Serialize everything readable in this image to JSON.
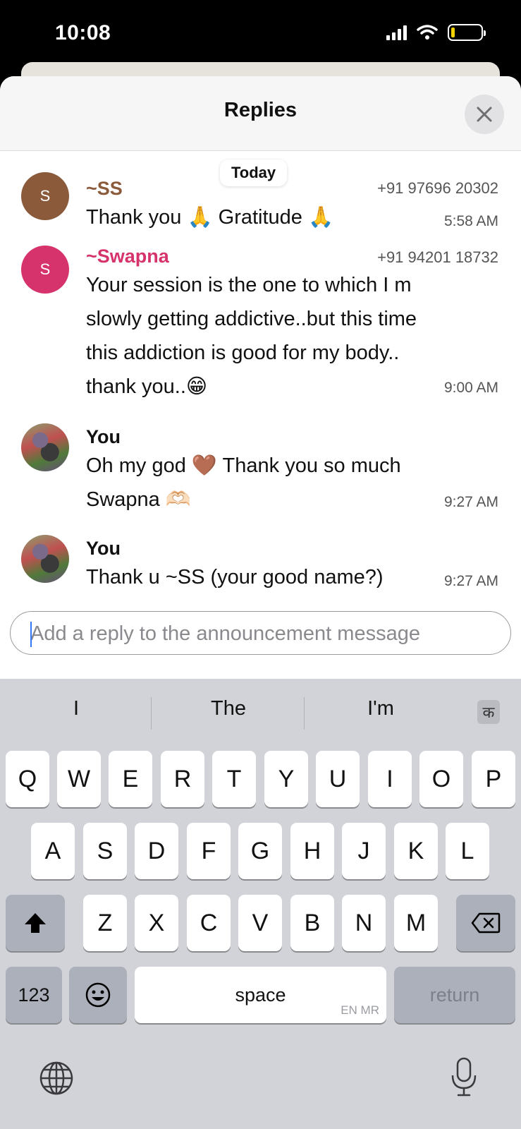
{
  "status_bar": {
    "time": "10:08"
  },
  "sheet": {
    "title": "Replies"
  },
  "date_pill": "Today",
  "messages": [
    {
      "avatar_letter": "S",
      "avatar_color": "#8a5a3b",
      "sender": "~SS",
      "sender_color": "#8a5a3b",
      "phone": "+91 97696 20302",
      "lines": [
        "Thank you 🙏 Gratitude 🙏"
      ],
      "time": "5:58 AM"
    },
    {
      "avatar_letter": "S",
      "avatar_color": "#d6336c",
      "sender": "~Swapna",
      "sender_color": "#d6336c",
      "phone": "+91 94201 18732",
      "lines": [
        "Your session is the one to which I m",
        "slowly getting addictive..but this time",
        "this addiction is good for my body..",
        "thank you..😁"
      ],
      "time": "9:00 AM"
    },
    {
      "avatar_letter": "",
      "sender": "You",
      "sender_color": "#111111",
      "phone": "",
      "lines": [
        "Oh my god 🤎 Thank you so much",
        "Swapna 🫶🏻"
      ],
      "time": "9:27 AM"
    },
    {
      "avatar_letter": "",
      "sender": "You",
      "sender_color": "#111111",
      "phone": "",
      "lines": [
        "Thank u ~SS (your good name?)"
      ],
      "time": "9:27 AM"
    }
  ],
  "reply_input": {
    "placeholder": "Add a reply to the announcement message",
    "value": ""
  },
  "keyboard": {
    "suggestions": [
      "I",
      "The",
      "I'm"
    ],
    "script_key": "क",
    "row1": [
      "Q",
      "W",
      "E",
      "R",
      "T",
      "Y",
      "U",
      "I",
      "O",
      "P"
    ],
    "row2": [
      "A",
      "S",
      "D",
      "F",
      "G",
      "H",
      "J",
      "K",
      "L"
    ],
    "row3": [
      "Z",
      "X",
      "C",
      "V",
      "B",
      "N",
      "M"
    ],
    "numbers_key": "123",
    "space_key": "space",
    "space_lang": "EN MR",
    "return_key": "return",
    "icons": {
      "shift": "shift-icon",
      "delete": "delete-icon",
      "emoji": "emoji-icon",
      "globe": "globe-icon",
      "mic": "mic-icon"
    }
  }
}
